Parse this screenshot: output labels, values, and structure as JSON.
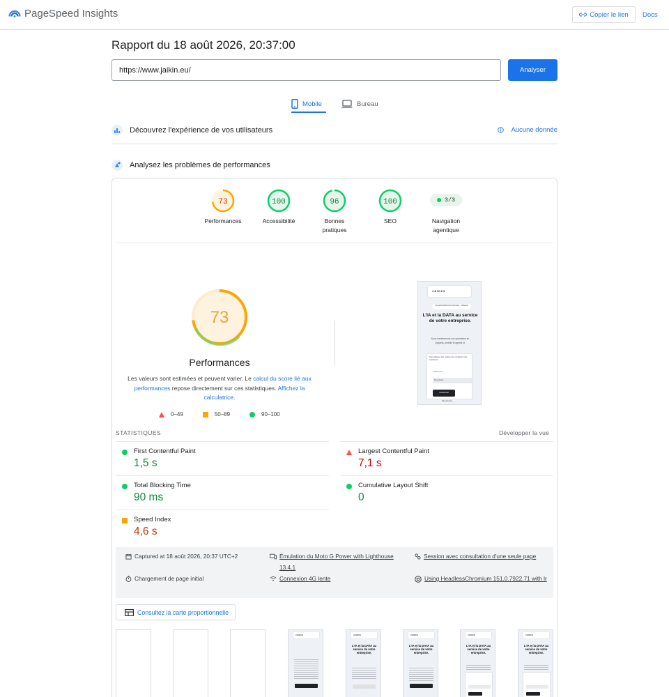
{
  "app": {
    "name": "PageSpeed Insights",
    "copy_link": "Copier le lien",
    "docs": "Docs"
  },
  "report": {
    "title": "Rapport du 18 août 2026, 20:37:00",
    "url": "https://www.jaikin.eu/",
    "analyze_label": "Analyser"
  },
  "tabs": [
    {
      "label": "Mobile",
      "active": true
    },
    {
      "label": "Bureau",
      "active": false
    }
  ],
  "sections": {
    "field_title": "Découvrez l'expérience de vos utilisateurs",
    "field_status": "Aucune donnée",
    "lab_title": "Analysez les problèmes de performances"
  },
  "scores": [
    {
      "value": "73",
      "label": "Performances",
      "level": "average"
    },
    {
      "value": "100",
      "label": "Accessibilité",
      "level": "good"
    },
    {
      "value": "96",
      "label": "Bonnes pratiques",
      "level": "good"
    },
    {
      "value": "100",
      "label": "SEO",
      "level": "good"
    }
  ],
  "agentic": {
    "value": "3/3",
    "label": "Navigation agentique"
  },
  "performance": {
    "score": "73",
    "score_fraction": 0.73,
    "title": "Performances",
    "note_start": "Les valeurs sont estimées et peuvent varier. Le ",
    "note_link1": "calcul du score lié aux performances",
    "note_mid": " repose directement sur ces statistiques. ",
    "note_link2": "Affichez la calculatrice.",
    "legend": [
      {
        "range": "0–49",
        "shape": "triangle",
        "color": "#ff4e42"
      },
      {
        "range": "50–89",
        "shape": "square",
        "color": "#ffa400"
      },
      {
        "range": "90–100",
        "shape": "circle",
        "color": "#0cce6b"
      }
    ]
  },
  "preview": {
    "brand": "JAIKIN",
    "chip": "TRANSFORMATION DIGITALE · FRANCE",
    "headline": "L'IA et la DATA au service de votre entreprise.",
    "body": "Nous transformons vos opérations en logiciels, portails et agents IA",
    "popup_text": "Nous utilisons des cookies pour améliorer votre expérience.",
    "popup_line": "Préférences",
    "popup_field": "Tout refuser",
    "popup_btn": "ACCEPTER",
    "footer": "Site sécurisé"
  },
  "stats": {
    "heading": "STATISTIQUES",
    "expand": "Développer la vue",
    "metrics": [
      {
        "name": "First Contentful Paint",
        "value": "1,5 s",
        "rating": "good"
      },
      {
        "name": "Largest Contentful Paint",
        "value": "7,1 s",
        "rating": "bad"
      },
      {
        "name": "Total Blocking Time",
        "value": "90 ms",
        "rating": "good"
      },
      {
        "name": "Cumulative Layout Shift",
        "value": "0",
        "rating": "good"
      },
      {
        "name": "Speed Index",
        "value": "4,6 s",
        "rating": "average"
      }
    ]
  },
  "run_info": {
    "captured": "Captured at 18 août 2026, 20:37 UTC+2",
    "device": "Émulation du Moto G Power with Lighthouse 13.4.1",
    "session": "Session avec consultation d'une seule page",
    "load": "Chargement de page initial",
    "network": "Connexion 4G lente",
    "browser": "Using HeadlessChromium 151.0.7922.71 with lr"
  },
  "treemap_label": "Consultez la carte proportionnelle",
  "filmstrip": {
    "frames": [
      {
        "state": "blank"
      },
      {
        "state": "blank"
      },
      {
        "state": "blank"
      },
      {
        "state": "partial"
      },
      {
        "state": "headline"
      },
      {
        "state": "headline"
      },
      {
        "state": "popup"
      },
      {
        "state": "popup"
      }
    ],
    "frame_brand": "JAIKIN",
    "frame_headline": "L'IA et la DATA au service de votre entreprise."
  },
  "colors": {
    "accent": "#1a73e8",
    "good": "#0cce6b",
    "average": "#ffa400",
    "bad": "#ff4e42"
  }
}
